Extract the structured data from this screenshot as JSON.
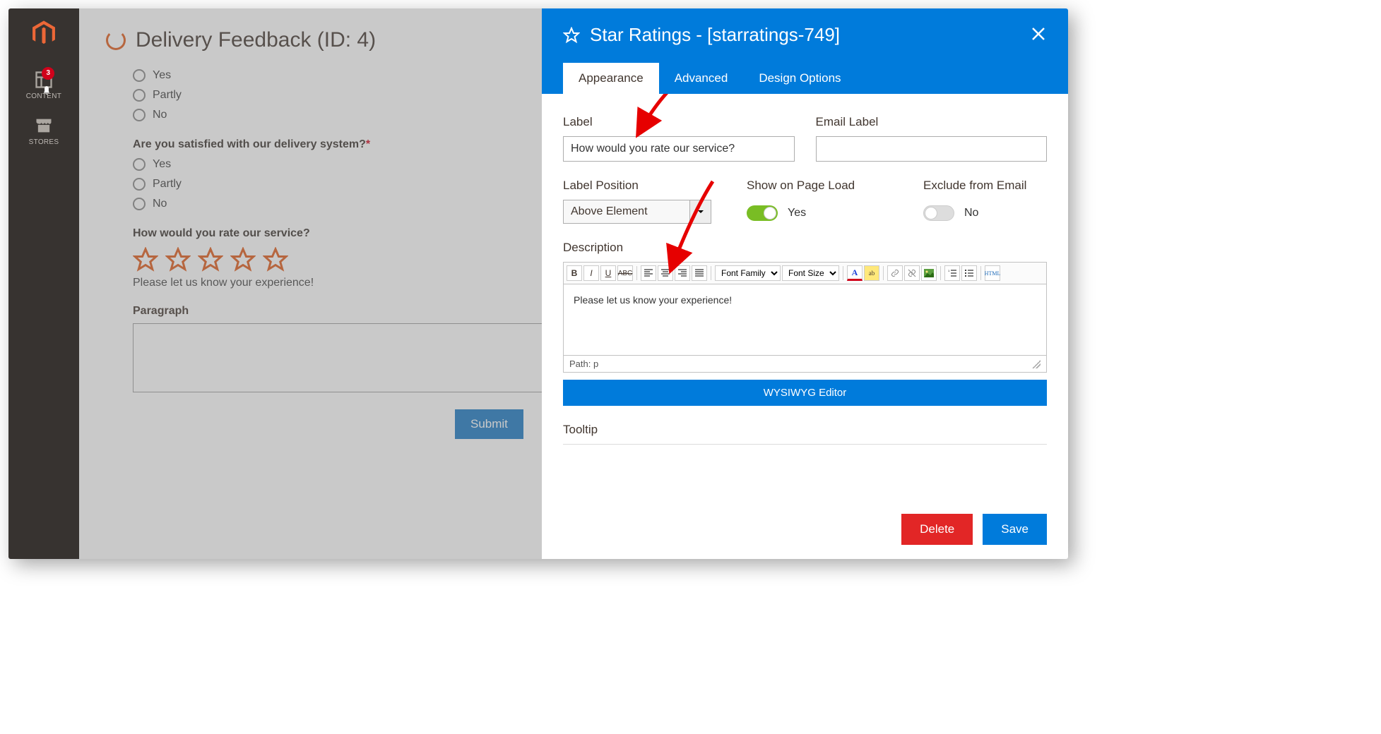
{
  "sidebar": {
    "content_label": "CONTENT",
    "stores_label": "STORES",
    "badge_count": "3"
  },
  "page": {
    "title": "Delivery Feedback (ID: 4)",
    "questions": {
      "q1_options": {
        "yes": "Yes",
        "partly": "Partly",
        "no": "No"
      },
      "q2_label": "Are you satisfied with our delivery system?",
      "q2_required_mark": "*",
      "q2_options": {
        "yes": "Yes",
        "partly": "Partly",
        "no": "No"
      },
      "rating_label": "How would you rate our service?",
      "rating_desc": "Please let us know your experience!",
      "paragraph_label": "Paragraph",
      "submit": "Submit"
    }
  },
  "panel": {
    "title": "Star Ratings - [starratings-749]",
    "tabs": {
      "appearance": "Appearance",
      "advanced": "Advanced",
      "design": "Design Options"
    },
    "fields": {
      "label_label": "Label",
      "label_value": "How would you rate our service?",
      "email_label_label": "Email Label",
      "email_label_value": "",
      "label_position_label": "Label Position",
      "label_position_value": "Above Element",
      "show_on_load_label": "Show on Page Load",
      "show_on_load_value": "Yes",
      "exclude_email_label": "Exclude from Email",
      "exclude_email_value": "No",
      "description_label": "Description",
      "description_value": "Please let us know your experience!",
      "editor_path": "Path: p",
      "wysiwyg_label": "WYSIWYG Editor",
      "tooltip_label": "Tooltip"
    },
    "toolbar": {
      "font_family": "Font Family",
      "font_size": "Font Size",
      "html": "HTML"
    },
    "footer": {
      "delete": "Delete",
      "save": "Save"
    }
  }
}
